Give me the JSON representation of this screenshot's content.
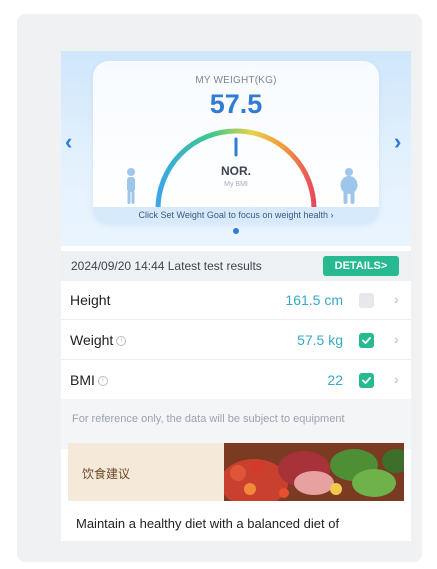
{
  "weight_card": {
    "title": "MY WEIGHT(KG)",
    "value": "57.5",
    "status": "NOR.",
    "status_sub": "My BMI",
    "goal_banner": "Click Set Weight Goal to focus on weight health ›",
    "prev_arrow": "‹",
    "next_arrow": "›"
  },
  "results": {
    "timestamp_text": "2024/09/20 14:44 Latest test results",
    "details_label": "DETAILS>"
  },
  "metrics": [
    {
      "label": "Height",
      "info": false,
      "value": "161.5 cm",
      "checked": false
    },
    {
      "label": "Weight",
      "info": true,
      "value": "57.5 kg",
      "checked": true
    },
    {
      "label": "BMI",
      "info": true,
      "value": "22",
      "checked": true
    }
  ],
  "disclaimer": "For reference only, the data will be subject to equipment",
  "diet": {
    "title": "饮食建议",
    "text": "Maintain a healthy diet with a balanced diet of"
  },
  "colors": {
    "accent": "#2f7bd6",
    "green": "#27b98f",
    "value_teal": "#38a9c9"
  }
}
